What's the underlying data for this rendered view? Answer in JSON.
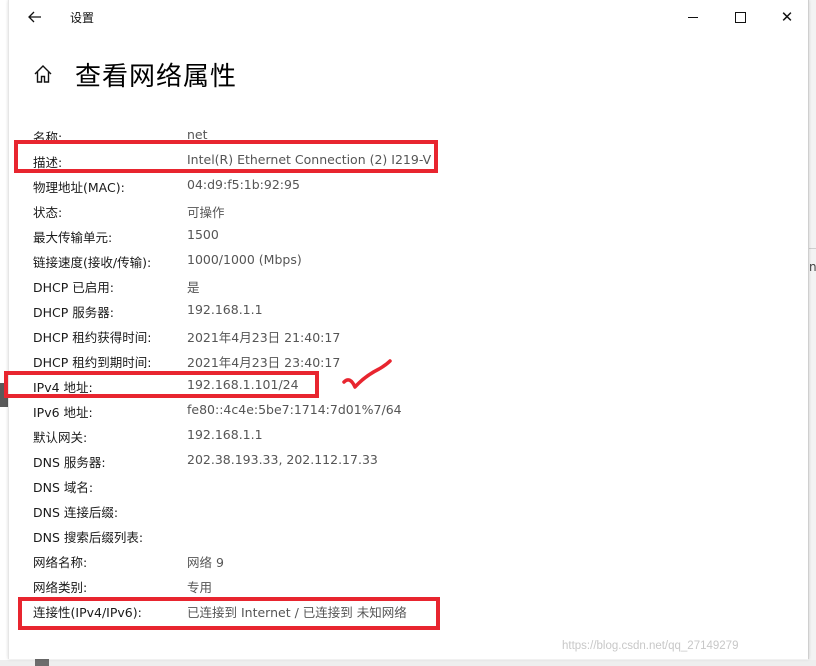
{
  "window": {
    "title": "设置"
  },
  "page": {
    "title": "查看网络属性"
  },
  "properties": [
    {
      "label": "名称:",
      "value": "net"
    },
    {
      "label": "描述:",
      "value": "Intel(R) Ethernet Connection (2) I219-V"
    },
    {
      "label": "物理地址(MAC):",
      "value": "04:d9:f5:1b:92:95"
    },
    {
      "label": "状态:",
      "value": "可操作"
    },
    {
      "label": "最大传输单元:",
      "value": "1500"
    },
    {
      "label": "链接速度(接收/传输):",
      "value": "1000/1000 (Mbps)"
    },
    {
      "label": "DHCP 已启用:",
      "value": "是"
    },
    {
      "label": "DHCP 服务器:",
      "value": "192.168.1.1"
    },
    {
      "label": "DHCP 租约获得时间:",
      "value": "2021年4月23日 21:40:17"
    },
    {
      "label": "DHCP 租约到期时间:",
      "value": "2021年4月23日 23:40:17"
    },
    {
      "label": "IPv4 地址:",
      "value": "192.168.1.101/24"
    },
    {
      "label": "IPv6 地址:",
      "value": "fe80::4c4e:5be7:1714:7d01%7/64"
    },
    {
      "label": "默认网关:",
      "value": "192.168.1.1"
    },
    {
      "label": "DNS 服务器:",
      "value": "202.38.193.33, 202.112.17.33"
    },
    {
      "label": "DNS 域名:",
      "value": ""
    },
    {
      "label": "DNS 连接后缀:",
      "value": ""
    },
    {
      "label": "DNS 搜索后缀列表:",
      "value": ""
    },
    {
      "label": "网络名称:",
      "value": "网络 9"
    },
    {
      "label": "网络类别:",
      "value": "专用"
    },
    {
      "label": "连接性(IPv4/IPv6):",
      "value": "已连接到 Internet / 已连接到 未知网络"
    }
  ],
  "background": {
    "partial_text": "np"
  },
  "watermark": "https://blog.csdn.net/qq_27149279",
  "colors": {
    "highlight": "#e8252f",
    "value_text": "#555555"
  },
  "icons": {
    "back": "back-arrow-icon",
    "home": "home-icon",
    "minimize": "minimize-icon",
    "maximize": "maximize-icon",
    "close": "close-icon"
  }
}
